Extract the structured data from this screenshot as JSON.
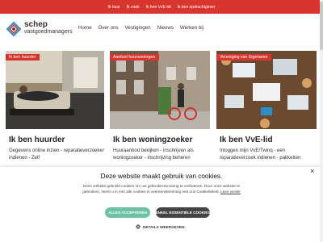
{
  "topbar": {
    "links": [
      "Ik huur",
      "Ik zoek",
      "Ik ben VvE-lid",
      "Ik ben opdrachtgever"
    ]
  },
  "logo": {
    "name": "schep",
    "sub": "vastgoedmanagers"
  },
  "nav": {
    "items": [
      "Home",
      "Over ons",
      "Vestigingen",
      "Nieuws",
      "Werken bij"
    ]
  },
  "cards": [
    {
      "tag": "Ik ben huurder",
      "title": "Ik ben huurder",
      "desc": "Gegevens online inzien - reparatieverzoeken indienen - Zelf"
    },
    {
      "tag": "Aanbod huurwoningen",
      "title": "Ik ben woningzoeker",
      "desc": "Huuraanbod bekijken - inschrijven als woningzoeker - inschrijving beheren"
    },
    {
      "tag": "Vereniging van Eigenaren",
      "title": "Ik ben VvE-lid",
      "desc": "Inloggen mijn VvE/Twinq - een reparatieverzoek indienen - pakketten"
    }
  ],
  "cookie": {
    "title": "Deze website maakt gebruik van cookies.",
    "text": "Deze website gebruikt cookies om uw gebruikerservaring te verbeteren. Door onze website te gebruiken, stemt u in met alle cookies in overeenstemming met ons Cookiebeleid.",
    "link": "Lees verder",
    "accept": "ALLES ACCEPTEREN",
    "essential": "ENKEL ESSENTIËLE COOKIES",
    "details": "DETAILS WEERGEVEN",
    "close": "×"
  },
  "colors": {
    "brand_red": "#d9352f",
    "accept_green": "#6cc1a7",
    "dark_button": "#444444"
  }
}
